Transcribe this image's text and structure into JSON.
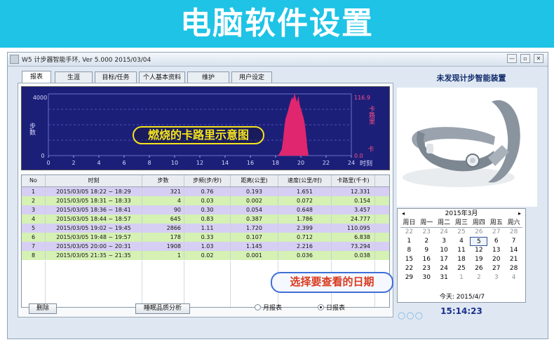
{
  "banner": {
    "title": "电脑软件设置"
  },
  "window": {
    "title": "W5  计步器智能手环, Ver 5.000  2015/03/04",
    "buttons": {
      "minimize": "—",
      "restore": "▫",
      "close": "✕"
    }
  },
  "tabs": [
    "报表",
    "生涯",
    "目标/任务",
    "个人基本资料",
    "维护",
    "用户设定"
  ],
  "chart": {
    "annotation": "燃烧的卡路里示意图",
    "left_axis_label": "步数",
    "right_axis_label": "卡路里",
    "right_unit": "卡",
    "x_unit": "时刻"
  },
  "chart_data": {
    "type": "area",
    "title": "",
    "xlabel": "时刻",
    "ylabel_left": "步数",
    "ylabel_right": "卡路里",
    "xlim": [
      0,
      24
    ],
    "ylim_left": [
      0,
      4000
    ],
    "ylim_right": [
      0.0,
      116.9
    ],
    "x_ticks": [
      0,
      2,
      4,
      6,
      8,
      10,
      12,
      14,
      16,
      18,
      20,
      22,
      24
    ],
    "y_left_ticks": [
      0,
      4000
    ],
    "y_right_ticks": [
      0.0,
      116.9
    ],
    "grid": true,
    "series": [
      {
        "name": "卡路里",
        "color": "#e0266e",
        "x": [
          18.2,
          18.3,
          18.5,
          18.6,
          18.7,
          18.8,
          19.0,
          19.1,
          19.2,
          19.3,
          19.4,
          19.5,
          19.6,
          19.7,
          19.8,
          19.9,
          20.0,
          20.1,
          20.2,
          20.3,
          20.4,
          20.5,
          20.6
        ],
        "y": [
          0,
          3,
          12,
          30,
          52,
          70,
          85,
          95,
          103,
          110,
          106,
          116.9,
          108,
          100,
          112,
          96,
          88,
          80,
          72,
          60,
          40,
          15,
          0
        ]
      }
    ]
  },
  "table": {
    "headers": [
      "No",
      "时刻",
      "步数",
      "步频(步/秒)",
      "距离(公里)",
      "速度(公里/时)",
      "卡路里(千卡)"
    ],
    "rows": [
      [
        "1",
        "2015/03/05 18:22 ~ 18:29",
        "321",
        "0.76",
        "0.193",
        "1.651",
        "12.331"
      ],
      [
        "2",
        "2015/03/05 18:31 ~ 18:33",
        "4",
        "0.03",
        "0.002",
        "0.072",
        "0.154"
      ],
      [
        "3",
        "2015/03/05 18:36 ~ 18:41",
        "90",
        "0.30",
        "0.054",
        "0.648",
        "3.457"
      ],
      [
        "4",
        "2015/03/05 18:44 ~ 18:57",
        "645",
        "0.83",
        "0.387",
        "1.786",
        "24.777"
      ],
      [
        "5",
        "2015/03/05 19:02 ~ 19:45",
        "2866",
        "1.11",
        "1.720",
        "2.399",
        "110.095"
      ],
      [
        "6",
        "2015/03/05 19:48 ~ 19:57",
        "178",
        "0.33",
        "0.107",
        "0.712",
        "6.838"
      ],
      [
        "7",
        "2015/03/05 20:00 ~ 20:31",
        "1908",
        "1.03",
        "1.145",
        "2.216",
        "73.294"
      ],
      [
        "8",
        "2015/03/05 21:35 ~ 21:35",
        "1",
        "0.02",
        "0.001",
        "0.036",
        "0.038"
      ]
    ]
  },
  "annotation_date": "选择要查看的日期",
  "buttons": {
    "delete": "删除",
    "sleep": "睡眠品质分析"
  },
  "report_mode": {
    "monthly": "月报表",
    "daily": "日报表",
    "selected": "daily"
  },
  "right_panel": {
    "device_status": "未发现计步智能装置"
  },
  "calendar": {
    "month_label": "2015年3月",
    "prev": "◂",
    "next": "▸",
    "weekdays": [
      "周日",
      "周一",
      "周二",
      "周三",
      "周四",
      "周五",
      "周六"
    ],
    "days": [
      [
        "22",
        "23",
        "24",
        "25",
        "26",
        "27",
        "28"
      ],
      [
        "1",
        "2",
        "3",
        "4",
        "5",
        "6",
        "7"
      ],
      [
        "8",
        "9",
        "10",
        "11",
        "12",
        "13",
        "14"
      ],
      [
        "15",
        "16",
        "17",
        "18",
        "19",
        "20",
        "21"
      ],
      [
        "22",
        "23",
        "24",
        "25",
        "26",
        "27",
        "28"
      ],
      [
        "29",
        "30",
        "31",
        "1",
        "2",
        "3",
        "4"
      ]
    ],
    "selected": "5",
    "today_label": "今天: 2015/4/7"
  },
  "clock": "15:14:23",
  "decor_dots": "○○○"
}
